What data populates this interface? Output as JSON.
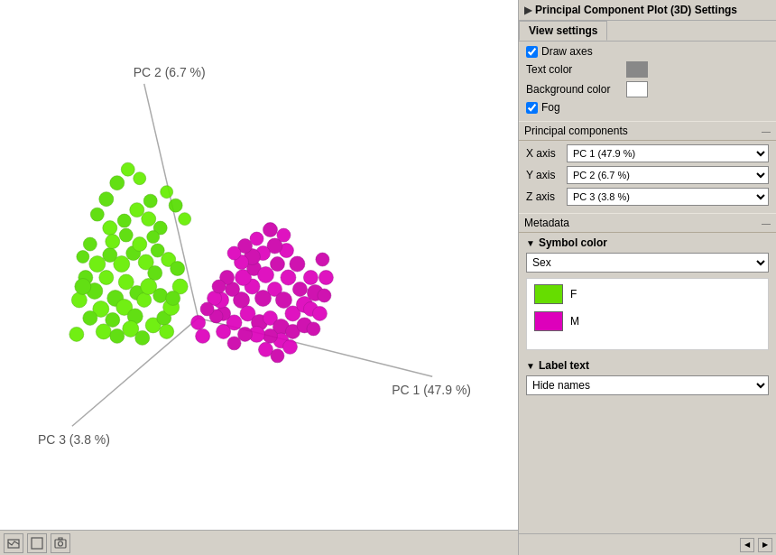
{
  "window": {
    "title": "Principal Component Plot (3D) Settings"
  },
  "settings_panel": {
    "title": "Principal Component Plot (3D) Settings",
    "view_settings_tab": "View settings",
    "draw_axes_label": "Draw axes",
    "draw_axes_checked": true,
    "text_color_label": "Text color",
    "background_color_label": "Background color",
    "fog_label": "Fog",
    "fog_checked": true,
    "principal_components_tab": "Principal components",
    "x_axis_label": "X axis",
    "y_axis_label": "Y axis",
    "z_axis_label": "Z axis",
    "x_axis_value": "PC 1 (47.9 %)",
    "y_axis_value": "PC 2 (6.7 %)",
    "z_axis_value": "PC 3 (3.8 %)",
    "metadata_tab": "Metadata",
    "symbol_color_label": "Symbol color",
    "symbol_color_dropdown": "Sex",
    "legend_f_label": "F",
    "legend_m_label": "M",
    "label_text_section": "Label text",
    "label_text_dropdown": "Hide names",
    "minimize_label": "—"
  },
  "plot": {
    "pc1_label": "PC 1 (47.9 %)",
    "pc2_label": "PC 2 (6.7 %)",
    "pc3_label": "PC 3 (3.8 %)"
  },
  "toolbar": {
    "btn1": "🗺",
    "btn2": "⬜",
    "btn3": "📷"
  },
  "colors": {
    "green": "#66dd00",
    "magenta": "#cc00aa",
    "axis": "#888888",
    "panel_bg": "#d4d0c8"
  }
}
